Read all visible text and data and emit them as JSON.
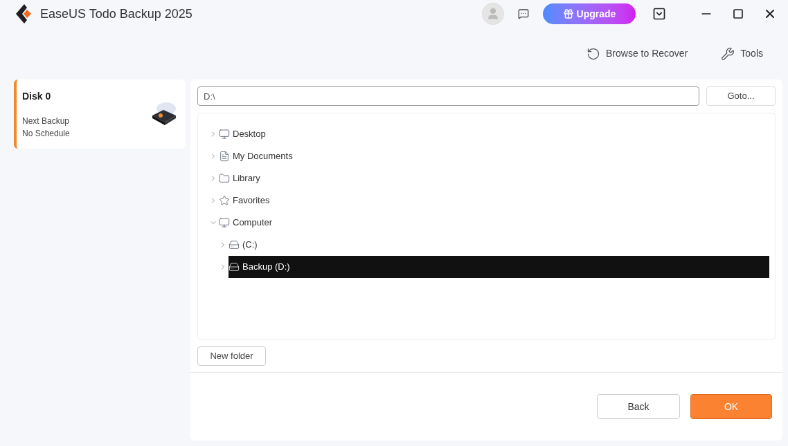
{
  "window": {
    "title": "EaseUS Todo Backup 2025"
  },
  "header": {
    "upgrade": "Upgrade"
  },
  "toolbar": [
    {
      "kind": "recover",
      "label": "Browse to Recover"
    },
    {
      "kind": "tools",
      "label": "Tools"
    }
  ],
  "sidebar": {
    "items": [
      {
        "title": "Disk 0",
        "line_1": "Next Backup",
        "line_2": "No Schedule",
        "selected": true
      }
    ]
  },
  "path_field": {
    "value": "D:\\",
    "button": "Goto..."
  },
  "tree": [
    {
      "label": "Desktop",
      "kind": "desktop",
      "expanded": false,
      "selected": false
    },
    {
      "label": "My Documents",
      "kind": "document",
      "expanded": false,
      "selected": false
    },
    {
      "label": "Library",
      "kind": "folder",
      "expanded": false,
      "selected": false
    },
    {
      "label": "Favorites",
      "kind": "favorites",
      "expanded": false,
      "selected": false
    },
    {
      "label": "Computer",
      "kind": "computer",
      "expanded": true,
      "selected": false,
      "children": [
        {
          "label": "(C:)",
          "kind": "drive",
          "expanded": false,
          "selected": false
        },
        {
          "label": "Backup (D:)",
          "kind": "drive",
          "expanded": false,
          "selected": true
        }
      ]
    }
  ],
  "new_folder": "New folder",
  "buttons": {
    "back": "Back",
    "ok": "OK"
  }
}
